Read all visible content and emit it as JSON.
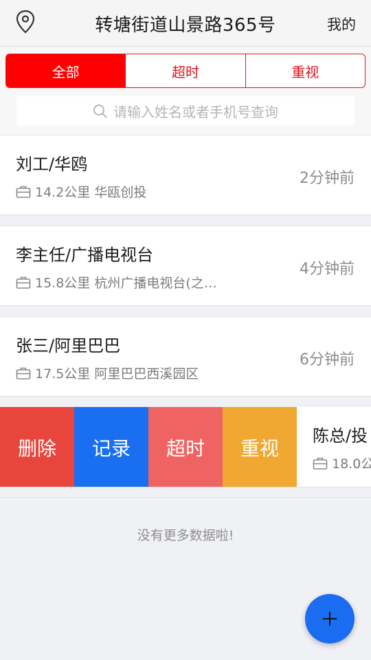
{
  "header": {
    "title": "转塘街道山景路365号",
    "mine_label": "我的",
    "location_icon": "location-pin-icon"
  },
  "tabs": [
    {
      "label": "全部",
      "active": true
    },
    {
      "label": "超时",
      "active": false
    },
    {
      "label": "重视",
      "active": false
    }
  ],
  "search": {
    "placeholder": "请输入姓名或者手机号查询"
  },
  "contacts": [
    {
      "name": "刘工/华鸥",
      "distance": "14.2公里",
      "company": "华瓯创投",
      "time": "2分钟前"
    },
    {
      "name": "李主任/广播电视台",
      "distance": "15.8公里",
      "company": "杭州广播电视台(之…",
      "time": "4分钟前"
    },
    {
      "name": "张三/阿里巴巴",
      "distance": "17.5公里",
      "company": "阿里巴巴西溪园区",
      "time": "6分钟前"
    }
  ],
  "swiped_item": {
    "name": "陈总/投",
    "distance": "18.0公"
  },
  "swipe_actions": [
    {
      "label": "删除",
      "color": "#e8463c"
    },
    {
      "label": "记录",
      "color": "#1a6ff0"
    },
    {
      "label": "超时",
      "color": "#f06363"
    },
    {
      "label": "重视",
      "color": "#f0a832"
    }
  ],
  "footer_note": "没有更多数据啦!",
  "colors": {
    "accent_red": "#e0141b",
    "fab_blue": "#1a6cf0"
  }
}
